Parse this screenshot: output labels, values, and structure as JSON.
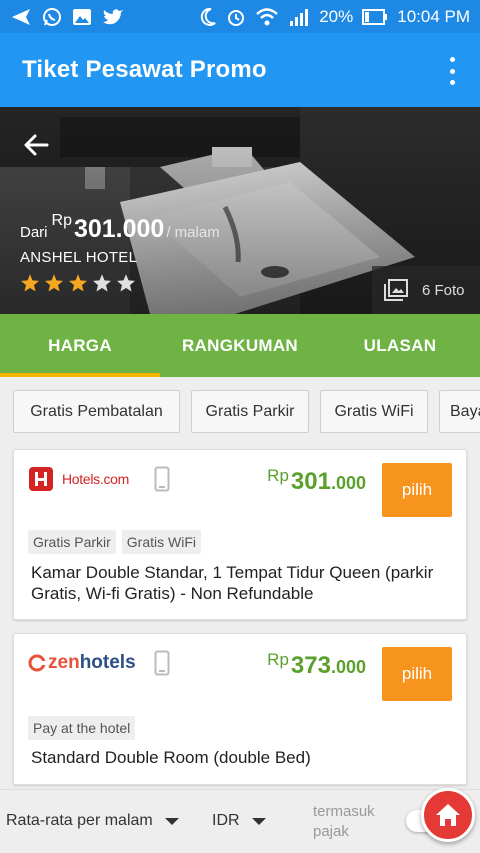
{
  "status_bar": {
    "battery": "20%",
    "time": "10:04 PM"
  },
  "app_bar": {
    "title": "Tiket Pesawat Promo"
  },
  "hotel": {
    "price_prefix": "Dari",
    "currency": "Rp",
    "price": "301.000",
    "price_unit": "/ malam",
    "name": "ANSHEL HOTEL",
    "rating": 3,
    "rating_max": 5,
    "photo_count_label": "6 Foto"
  },
  "tabs": [
    {
      "label": "HARGA",
      "active": true
    },
    {
      "label": "RANGKUMAN",
      "active": false
    },
    {
      "label": "ULASAN",
      "active": false
    }
  ],
  "filters": [
    "Gratis Pembatalan",
    "Gratis Parkir",
    "Gratis WiFi",
    "Bayar di hotel"
  ],
  "offers": [
    {
      "provider": "Hotels.com",
      "currency": "Rp",
      "price_main": "301",
      "price_decimal": ".000",
      "button": "pilih",
      "tags": [
        "Gratis Parkir",
        "Gratis WiFi"
      ],
      "room": "Kamar Double Standar, 1 Tempat Tidur Queen (parkir Gratis, Wi-fi Gratis) - Non Refundable"
    },
    {
      "provider_prefix": "zen",
      "provider_suffix": "hotels",
      "currency": "Rp",
      "price_main": "373",
      "price_decimal": ".000",
      "button": "pilih",
      "tags": [
        "Pay at the hotel"
      ],
      "room": "Standard Double Room (double Bed)"
    }
  ],
  "bottom_bar": {
    "average_label": "Rata-rata per malam",
    "currency_label": "IDR",
    "tax_label": "termasuk pajak"
  },
  "colors": {
    "status_bar": "#1e88e5",
    "app_bar": "#2196f3",
    "tabs": "#6fb345",
    "tab_indicator": "#f5b400",
    "price_green": "#5aa02c",
    "select_button": "#f7941d",
    "star": "#f5a623",
    "home_fab": "#e53935"
  }
}
